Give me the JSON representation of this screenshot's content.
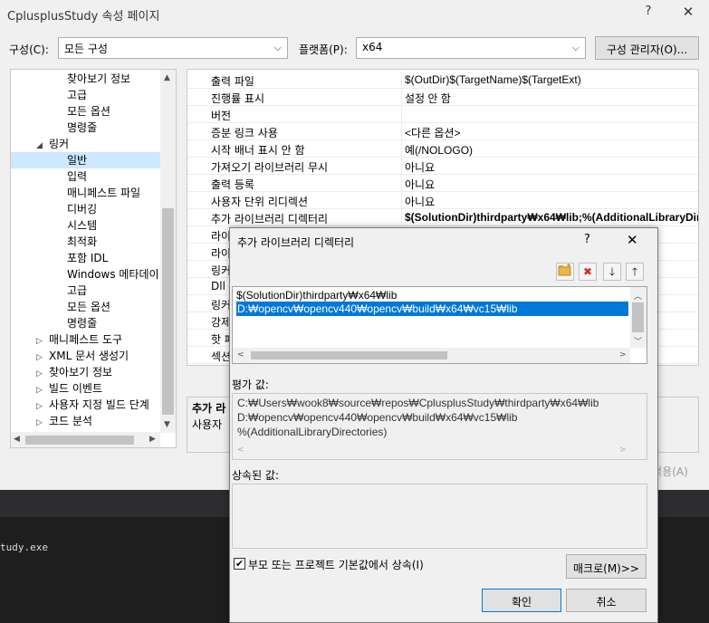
{
  "window": {
    "title": "CplusplusStudy 속성 페이지",
    "help": "?",
    "close": "✕"
  },
  "toolbar": {
    "config_label": "구성(C):",
    "config_value": "모든 구성",
    "platform_label": "플랫폼(P):",
    "platform_value": "x64",
    "config_manager": "구성 관리자(O)..."
  },
  "tree": {
    "items": [
      {
        "label": "찾아보기 정보"
      },
      {
        "label": "고급"
      },
      {
        "label": "모든 옵션"
      },
      {
        "label": "명령줄"
      },
      {
        "label": "링커"
      },
      {
        "label": "일반"
      },
      {
        "label": "입력"
      },
      {
        "label": "매니페스트 파일"
      },
      {
        "label": "디버깅"
      },
      {
        "label": "시스템"
      },
      {
        "label": "최적화"
      },
      {
        "label": "포함 IDL"
      },
      {
        "label": "Windows 메타데이"
      },
      {
        "label": "고급"
      },
      {
        "label": "모든 옵션"
      },
      {
        "label": "명령줄"
      },
      {
        "label": "매니페스트 도구"
      },
      {
        "label": "XML 문서 생성기"
      },
      {
        "label": "찾아보기 정보"
      },
      {
        "label": "빌드 이벤트"
      },
      {
        "label": "사용자 지정 빌드 단계"
      },
      {
        "label": "코드 분석"
      }
    ]
  },
  "grid": {
    "rows": [
      {
        "name": "출력 파일",
        "value": "$(OutDir)$(TargetName)$(TargetExt)"
      },
      {
        "name": "진행률 표시",
        "value": "설정 안 함"
      },
      {
        "name": "버전",
        "value": ""
      },
      {
        "name": "증분 링크 사용",
        "value": "<다른 옵션>"
      },
      {
        "name": "시작 배너 표시 안 함",
        "value": "예(/NOLOGO)"
      },
      {
        "name": "가져오기 라이브러리 무시",
        "value": "아니요"
      },
      {
        "name": "출력 등록",
        "value": "아니요"
      },
      {
        "name": "사용자 단위 리디렉션",
        "value": "아니요"
      },
      {
        "name": "추가 라이브러리 디렉터리",
        "value": "$(SolutionDir)thirdparty₩x64₩lib;%(AdditionalLibraryDire"
      },
      {
        "name": "라이",
        "value": ""
      },
      {
        "name": "라이",
        "value": ""
      },
      {
        "name": "링커",
        "value": ""
      },
      {
        "name": "Dll",
        "value": ""
      },
      {
        "name": "링커",
        "value": ""
      },
      {
        "name": "강제",
        "value": ""
      },
      {
        "name": "핫 패",
        "value": ""
      },
      {
        "name": "섹션",
        "value": ""
      }
    ],
    "desc_title": "추가 라",
    "desc_text": "사용자",
    "apply": "적용(A)"
  },
  "output": {
    "text": "tudy.exe"
  },
  "dialog": {
    "title": "추가 라이브러리 디렉터리",
    "help": "?",
    "close": "✕",
    "list": [
      "$(SolutionDir)thirdparty₩x64₩lib",
      "D:₩opencv₩opencv440₩opencv₩build₩x64₩vc15₩lib"
    ],
    "eval_label": "평가 값:",
    "eval_lines": [
      "C:₩Users₩wook8₩source₩repos₩CplusplusStudy₩thirdparty₩x64₩lib",
      "D:₩opencv₩opencv440₩opencv₩build₩x64₩vc15₩lib",
      "%(AdditionalLibraryDirectories)"
    ],
    "inherited_label": "상속된 값:",
    "inherit_check_label": "부모 또는 프로젝트 기본값에서 상속(I)",
    "macro_button": "매크로(M)>>",
    "ok_button": "확인",
    "cancel_button": "취소"
  },
  "colors": {
    "selection": "#0078d7",
    "tree_selection": "#cde8ff",
    "new_folder_icon": "#e8b84a",
    "delete_icon": "#d32f2f",
    "output_bg": "#1e1e1e"
  }
}
